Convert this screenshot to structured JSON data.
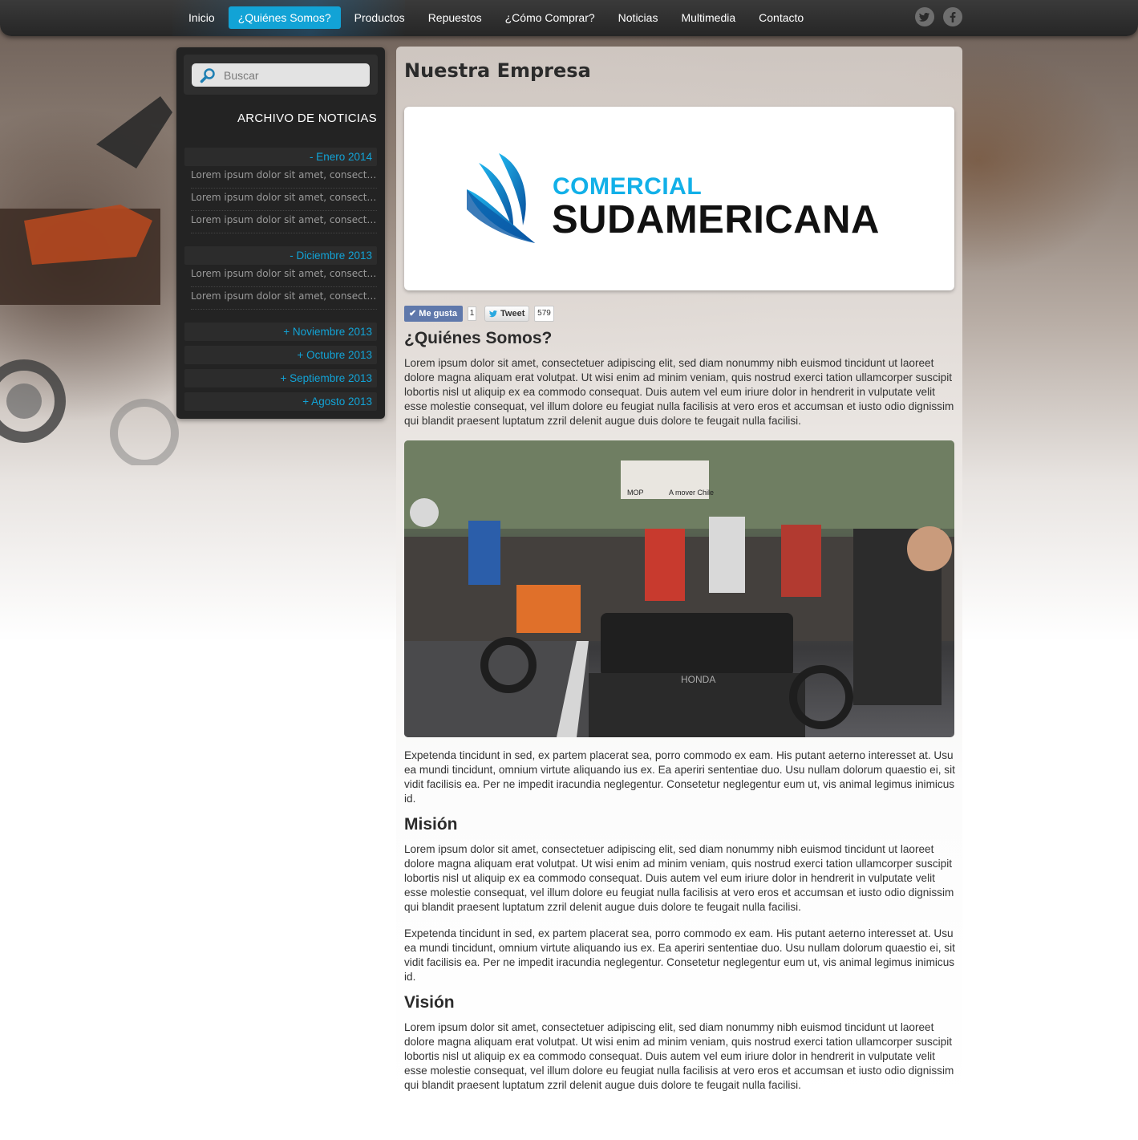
{
  "nav": {
    "items": [
      {
        "label": "Inicio",
        "active": false
      },
      {
        "label": "¿Quiénes Somos?",
        "active": true
      },
      {
        "label": "Productos",
        "active": false
      },
      {
        "label": "Repuestos",
        "active": false
      },
      {
        "label": "¿Cómo Comprar?",
        "active": false
      },
      {
        "label": "Noticias",
        "active": false
      },
      {
        "label": "Multimedia",
        "active": false
      },
      {
        "label": "Contacto",
        "active": false
      }
    ],
    "social": {
      "twitter_icon": "twitter-icon",
      "facebook_icon": "facebook-icon"
    },
    "active_color": "#12a3d6"
  },
  "sidebar": {
    "search_placeholder": "Buscar",
    "archive_title": "ARCHIVO DE NOTICIAS",
    "months": [
      {
        "label": "- Enero 2014",
        "articles": [
          "Lorem ipsum dolor sit amet, consectetuer adipiscing",
          "Lorem ipsum dolor sit amet, consectetuer adipiscing",
          "Lorem ipsum dolor sit amet, consectetuer adipiscing"
        ]
      },
      {
        "label": "- Diciembre 2013",
        "articles": [
          "Lorem ipsum dolor sit amet, consectetuer adipiscing",
          "Lorem ipsum dolor sit amet, consectetuer adipiscing"
        ]
      },
      {
        "label": "+ Noviembre 2013",
        "articles": []
      },
      {
        "label": "+ Octubre 2013",
        "articles": []
      },
      {
        "label": "+ Septiembre 2013",
        "articles": []
      },
      {
        "label": "+ Agosto 2013",
        "articles": []
      }
    ]
  },
  "main": {
    "title": "Nuestra Empresa",
    "logo": {
      "line1": "COMERCIAL",
      "line2": "SUDAMERICANA"
    },
    "share": {
      "like_label": "Me gusta",
      "like_count": "1",
      "tweet_label": "Tweet",
      "tweet_count": "579"
    },
    "sections": [
      {
        "heading": "¿Quiénes Somos?"
      },
      {
        "heading": "Misión"
      },
      {
        "heading": "Visión"
      }
    ],
    "paragraphs": {
      "about1": "Lorem ipsum dolor sit amet, consectetuer adipiscing elit, sed diam nonummy nibh euismod tincidunt ut laoreet dolore magna aliquam erat volutpat. Ut wisi enim ad minim veniam, quis nostrud exerci tation ullamcorper suscipit lobortis nisl ut aliquip ex ea commodo consequat. Duis autem vel eum iriure dolor in hendrerit in vulputate velit esse molestie consequat, vel illum dolore eu feugiat nulla facilisis at vero eros et accumsan et iusto odio dignissim qui blandit praesent luptatum zzril delenit augue duis dolore te feugait nulla facilisi.",
      "about2": "Expetenda tincidunt in sed, ex partem placerat sea, porro commodo ex eam. His putant aeterno interesset at. Usu ea mundi tincidunt, omnium virtute aliquando ius ex. Ea aperiri sententiae duo. Usu nullam dolorum quaestio ei, sit vidit facilisis ea. Per ne impedit iracundia neglegentur. Consetetur neglegentur eum ut, vis animal legimus inimicus id.",
      "mision1": "Lorem ipsum dolor sit amet, consectetuer adipiscing elit, sed diam nonummy nibh euismod tincidunt ut laoreet dolore magna aliquam erat volutpat. Ut wisi enim ad minim veniam, quis nostrud exerci tation ullamcorper suscipit lobortis nisl ut aliquip ex ea commodo consequat. Duis autem vel eum iriure dolor in hendrerit in vulputate velit esse molestie consequat, vel illum dolore eu feugiat nulla facilisis at vero eros et accumsan et iusto odio dignissim qui blandit praesent luptatum zzril delenit augue duis dolore te feugait nulla facilisi.",
      "mision2": "Expetenda tincidunt in sed, ex partem placerat sea, porro commodo ex eam. His putant aeterno interesset at. Usu ea mundi tincidunt, omnium virtute aliquando ius ex. Ea aperiri sententiae duo. Usu nullam dolorum quaestio ei, sit vidit facilisis ea. Per ne impedit iracundia neglegentur. Consetetur neglegentur eum ut, vis animal legimus inimicus id.",
      "vision1": "Lorem ipsum dolor sit amet, consectetuer adipiscing elit, sed diam nonummy nibh euismod tincidunt ut laoreet dolore magna aliquam erat volutpat. Ut wisi enim ad minim veniam, quis nostrud exerci tation ullamcorper suscipit lobortis nisl ut aliquip ex ea commodo consequat. Duis autem vel eum iriure dolor in hendrerit in vulputate velit esse molestie consequat, vel illum dolore eu feugiat nulla facilisis at vero eros et accumsan et iusto odio dignissim qui blandit praesent luptatum zzril delenit augue duis dolore te feugait nulla facilisi."
    },
    "photo_sign": {
      "line1": "MOP",
      "line2": "A mover Chile"
    },
    "photo_vehicle_brand": "HONDA"
  }
}
